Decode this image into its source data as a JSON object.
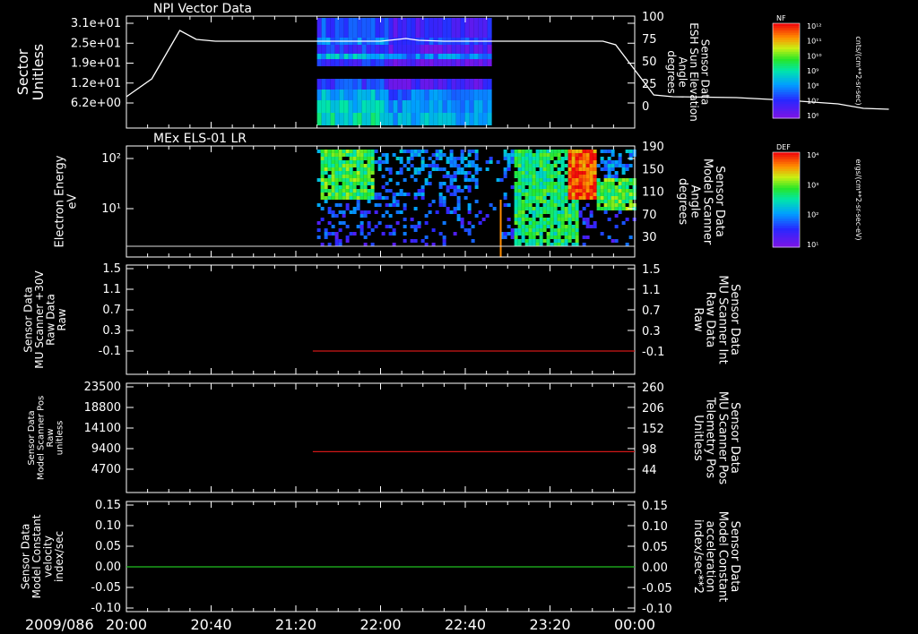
{
  "chart_data": {
    "type": "stacked-timeseries",
    "date_label": "2009/086",
    "x_ticks": [
      "20:00",
      "20:40",
      "21:20",
      "22:00",
      "22:40",
      "23:20",
      "00:00"
    ],
    "panels": [
      {
        "id": "npi",
        "title": "NPI Vector Data",
        "ylabel_left": [
          "Sector",
          "Unitless"
        ],
        "ticks_left": [
          "3.1e+01",
          "2.5e+01",
          "1.9e+01",
          "1.2e+01",
          "6.2e+00"
        ],
        "ylabel_right": [
          "Sensor Data",
          "ESH Sun Elevation",
          "Angle",
          "degrees"
        ],
        "ticks_right": [
          "100",
          "75",
          "50",
          "25",
          "0"
        ],
        "colorbar": {
          "label": "NF",
          "ticks": [
            "10¹²",
            "10¹¹",
            "10¹⁰",
            "10⁹",
            "10⁸",
            "10⁷",
            "10⁶"
          ],
          "units": "cnts/(cm**2-sr-sec)"
        },
        "line_series": {
          "name": "ESH Sun Elevation Angle",
          "x_hours": [
            0,
            0.2,
            0.42,
            0.55,
            0.7,
            1.0,
            1.4,
            1.8,
            2.0,
            2.2,
            2.3,
            2.5,
            3.0,
            3.5,
            3.75,
            3.85,
            4.0,
            4.15,
            4.3,
            4.8,
            5.2,
            5.6,
            5.8,
            6.0
          ],
          "y": [
            10,
            30,
            84,
            74,
            72,
            72,
            72,
            72,
            72,
            75,
            73,
            72,
            72,
            72,
            72,
            68,
            40,
            12,
            10,
            9,
            6,
            2,
            -3,
            -4
          ]
        },
        "spectrogram_span": [
          "21:30",
          "22:52"
        ]
      },
      {
        "id": "els",
        "title": "MEx ELS-01 LR",
        "ylabel_left": [
          "Electron Energy",
          "eV"
        ],
        "ticks_left": [
          "10²",
          "10¹"
        ],
        "ylabel_right": [
          "Sensor Data",
          "Model Scanner",
          "Angle",
          "degrees"
        ],
        "ticks_right": [
          "190",
          "150",
          "110",
          "70",
          "30"
        ],
        "colorbar": {
          "label": "DEF",
          "ticks": [
            "10⁴",
            "10³",
            "10²",
            "10¹"
          ],
          "units": "ergs/(cm**2-sr-sec-eV)"
        },
        "spectrogram_span": [
          "21:30",
          "00:00"
        ]
      },
      {
        "id": "mu30",
        "ylabel_left": [
          "Sensor Data",
          "MU Scanner +30V",
          "Raw Data",
          "Raw"
        ],
        "ticks_left": [
          "1.5",
          "1.1",
          "0.7",
          "0.3",
          "-0.1"
        ],
        "ylabel_right": [
          "Sensor Data",
          "MU Scanner Int",
          "Raw Data",
          "Raw"
        ],
        "ticks_right": [
          "1.5",
          "1.1",
          "0.7",
          "0.3",
          "-0.1"
        ],
        "right_color": "#ff2020",
        "line_series": {
          "name": "MU Scanner Int Raw Data",
          "x_from": "21:28",
          "x_to": "00:00",
          "y": -0.1,
          "color": "#d01818"
        }
      },
      {
        "id": "mupos",
        "ylabel_left": [
          "Sensor Data",
          "Model Scanner Pos",
          "Raw",
          "unitless"
        ],
        "ticks_left": [
          "23500",
          "18800",
          "14100",
          "9400",
          "4700"
        ],
        "ylabel_right": [
          "Sensor Data",
          "MU Scanner Pos",
          "Telemetry Pos",
          "Unitless"
        ],
        "ticks_right": [
          "260",
          "206",
          "152",
          "98",
          "44"
        ],
        "right_color": "#ff2020",
        "line_series": {
          "name": "MU Scanner Pos Telemetry",
          "x_from": "21:28",
          "x_to": "00:00",
          "y": 90,
          "color": "#d01818"
        }
      },
      {
        "id": "vel",
        "ylabel_left": [
          "Sensor Data",
          "Model Constant",
          "velocity",
          "index/sec"
        ],
        "ticks_left": [
          "0.15",
          "0.10",
          "0.05",
          "0.00",
          "-0.05",
          "-0.10"
        ],
        "ylabel_right": [
          "Sensor Data",
          "Model Constant",
          "acceleration",
          "index/sec**2"
        ],
        "ticks_right": [
          "0.15",
          "0.10",
          "0.05",
          "0.00",
          "-0.05",
          "-0.10"
        ],
        "right_color": "#20e020",
        "line_series": {
          "name": "Model Constant",
          "x_from": "20:00",
          "x_to": "00:00",
          "y": 0.0,
          "color": "#20c020"
        }
      }
    ]
  }
}
